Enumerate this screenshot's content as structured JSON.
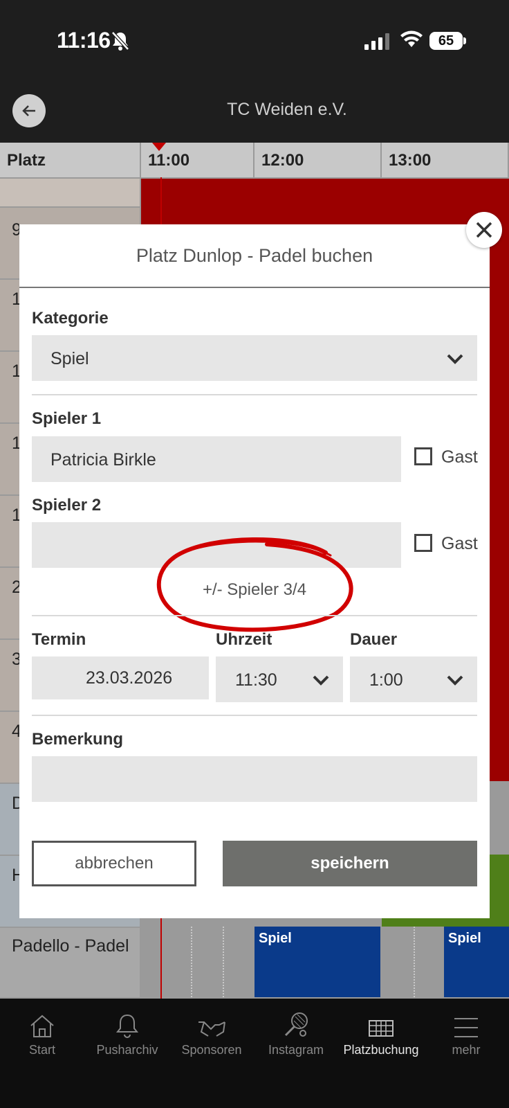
{
  "status_bar": {
    "time": "11:16",
    "battery": "65"
  },
  "app": {
    "title": "TC Weiden e.V."
  },
  "grid": {
    "corner_label": "Platz",
    "times": [
      "11:00",
      "12:00",
      "13:00"
    ],
    "row_stubs": [
      "9",
      "1",
      "1",
      "1",
      "1",
      "2",
      "3",
      "4",
      "D",
      "H"
    ],
    "last_row_label": "Padello - Padel",
    "event_label": "Spiel"
  },
  "modal": {
    "title": "Platz Dunlop - Padel buchen",
    "kategorie_label": "Kategorie",
    "kategorie_value": "Spiel",
    "spieler1_label": "Spieler 1",
    "spieler1_value": "Patricia Birkle",
    "spieler2_label": "Spieler 2",
    "spieler2_value": "",
    "gast_label": "Gast",
    "toggle_players": "+/- Spieler 3/4",
    "termin_label": "Termin",
    "termin_value": "23.03.2026",
    "uhrzeit_label": "Uhrzeit",
    "uhrzeit_value": "11:30",
    "dauer_label": "Dauer",
    "dauer_value": "1:00",
    "bemerkung_label": "Bemerkung",
    "bemerkung_value": "",
    "cancel_label": "abbrechen",
    "save_label": "speichern"
  },
  "nav": {
    "items": [
      {
        "label": "Start",
        "icon": "home-icon"
      },
      {
        "label": "Pusharchiv",
        "icon": "bell-icon"
      },
      {
        "label": "Sponsoren",
        "icon": "handshake-icon"
      },
      {
        "label": "Instagram",
        "icon": "racket-icon"
      },
      {
        "label": "Platzbuchung",
        "icon": "court-icon",
        "active": true
      },
      {
        "label": "mehr",
        "icon": "menu-icon"
      }
    ]
  },
  "colors": {
    "booked": "#9b0000",
    "event": "#0a3a8a",
    "accent_green": "#4f7f19",
    "annotation": "#d10000"
  }
}
